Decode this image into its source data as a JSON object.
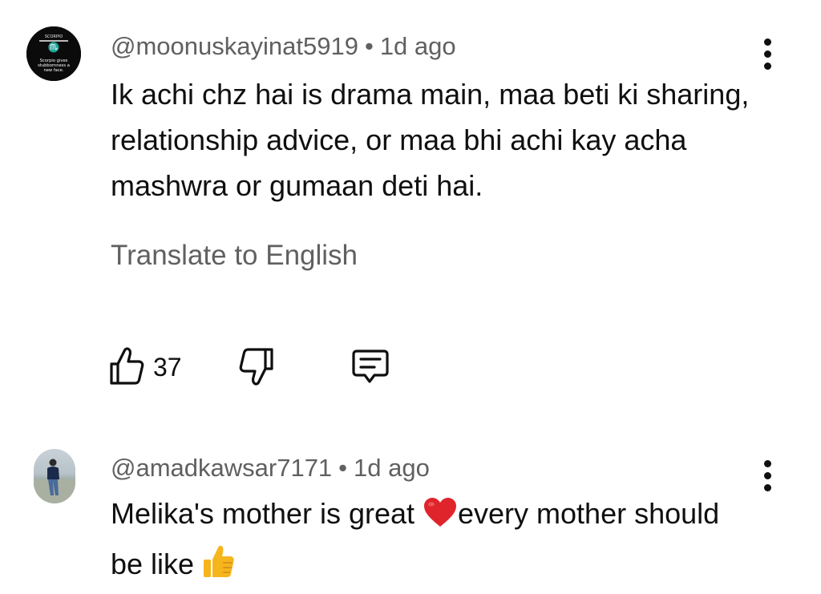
{
  "comments": [
    {
      "author": "@moonuskayinat5919",
      "separator": "•",
      "time": "1d ago",
      "text": "Ik achi chz hai is drama main, maa beti ki sharing, relationship advice, or maa bhi achi kay acha mashwra or gumaan deti hai.",
      "translate_label": "Translate to English",
      "likes": "37",
      "avatar_text": {
        "top": "SCORPIO",
        "main": "Scorpio gives stubbornness a new face."
      },
      "icons": {
        "like": "thumbs-up-outline-icon",
        "dislike": "thumbs-down-outline-icon",
        "reply": "reply-comment-icon",
        "menu": "more-vert-icon"
      }
    },
    {
      "author": "@amadkawsar7171",
      "separator": "•",
      "time": "1d ago",
      "text_part1": "Melika's mother is great ",
      "text_part2": "every mother should be like ",
      "emojis": [
        "red-heart-emoji",
        "thumbs-up-emoji"
      ],
      "icons": {
        "menu": "more-vert-icon"
      }
    }
  ],
  "colors": {
    "primary_text": "#0f0f0f",
    "secondary_text": "#606060",
    "heart": "#e0242c",
    "thumb_emoji": "#f5b51c"
  }
}
